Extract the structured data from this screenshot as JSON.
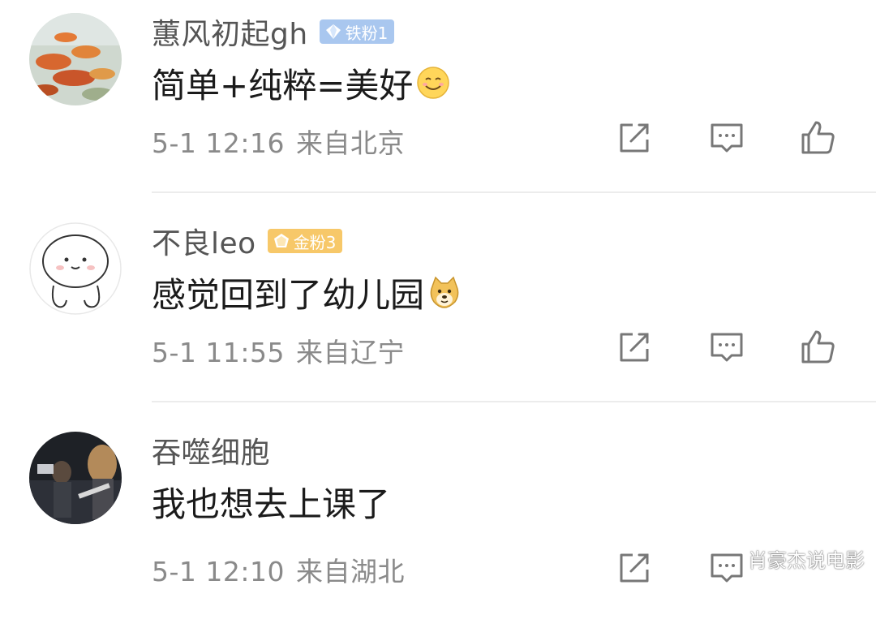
{
  "comments": [
    {
      "username": "蕙风初起gh",
      "badge": "铁粉1",
      "badge_type": "iron",
      "text": "简单+纯粹=美好",
      "emoji": "smile-emoji",
      "time": "5-1 12:16",
      "location": "来自北京"
    },
    {
      "username": "不良leo",
      "badge": "金粉3",
      "badge_type": "gold",
      "text": "感觉回到了幼儿园",
      "emoji": "doge-emoji",
      "time": "5-1 11:55",
      "location": "来自辽宁"
    },
    {
      "username": "吞噬细胞",
      "badge": "",
      "text": "我也想去上课了",
      "emoji": "",
      "time": "5-1 12:10",
      "location": "来自湖北"
    }
  ],
  "icons": [
    "share-icon",
    "reply-icon",
    "like-icon"
  ],
  "colors": {
    "iron_badge": "#a9c7ef",
    "gold_badge": "#f7c869",
    "meta_text": "#8a8a8a",
    "username": "#555555"
  },
  "watermark": "肖豪杰说电影"
}
